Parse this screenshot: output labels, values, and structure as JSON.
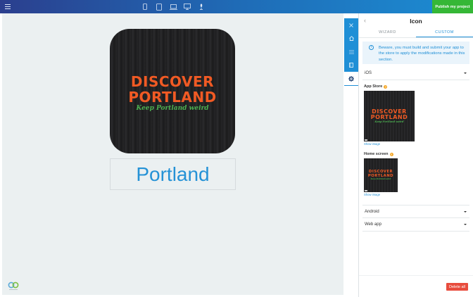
{
  "topbar": {
    "devices": [
      "smartphone-icon",
      "tablet-icon",
      "laptop-icon",
      "desktop-icon",
      "microphone-icon"
    ],
    "publish_label": "Publish my project"
  },
  "canvas": {
    "app_icon": {
      "line1": "DISCOVER",
      "line2": "PORTLAND",
      "tagline": "Keep Portland weird"
    },
    "app_name": "Portland"
  },
  "rail": {
    "items": [
      "close-icon",
      "home-icon",
      "list-icon",
      "book-icon",
      "gear-icon"
    ]
  },
  "panel": {
    "title": "Icon",
    "tabs": [
      "WIZARD",
      "CUSTOM"
    ],
    "active_tab": "CUSTOM",
    "warning": "Beware, you must build and submit your app to the store to apply the modifications made in this section.",
    "ios_label": "iOS",
    "app_store_label": "App Store",
    "home_screen_label": "Home screen",
    "show_image": "Show image",
    "android_label": "Android",
    "webapp_label": "Web app",
    "delete_label": "Delete all"
  },
  "colors": {
    "accent": "#1f8fd6",
    "publish": "#35b736",
    "delete": "#e84c3d",
    "icon_text": "#f15a24",
    "icon_tagline": "#4caf50"
  }
}
